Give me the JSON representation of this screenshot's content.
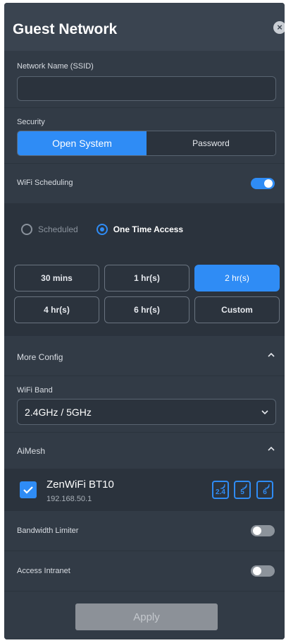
{
  "header": {
    "title": "Guest Network"
  },
  "ssid": {
    "label": "Network Name (SSID)",
    "value": ""
  },
  "security": {
    "label": "Security",
    "options": [
      "Open System",
      "Password"
    ],
    "selected": "Open System"
  },
  "wifi_scheduling": {
    "label": "WiFi Scheduling",
    "enabled": true
  },
  "access_mode": {
    "options": [
      "Scheduled",
      "One Time Access"
    ],
    "selected": "One Time Access"
  },
  "durations": {
    "options": [
      "30 mins",
      "1 hr(s)",
      "2 hr(s)",
      "4 hr(s)",
      "6 hr(s)",
      "Custom"
    ],
    "selected": "2 hr(s)"
  },
  "more_config": {
    "label": "More Config"
  },
  "wifi_band": {
    "label": "WiFi Band",
    "value": "2.4GHz / 5GHz"
  },
  "aimesh": {
    "label": "AiMesh",
    "node": {
      "name": "ZenWiFi BT10",
      "ip": "192.168.50.1",
      "checked": true,
      "bands": [
        "2.4",
        "5",
        "6"
      ]
    }
  },
  "bandwidth_limiter": {
    "label": "Bandwidth Limiter",
    "enabled": false
  },
  "access_intranet": {
    "label": "Access Intranet",
    "enabled": false
  },
  "apply": {
    "label": "Apply"
  },
  "colors": {
    "accent": "#2f8cf5",
    "panel": "#2b333d",
    "section": "#323b46",
    "disabled": "#8c9198"
  }
}
